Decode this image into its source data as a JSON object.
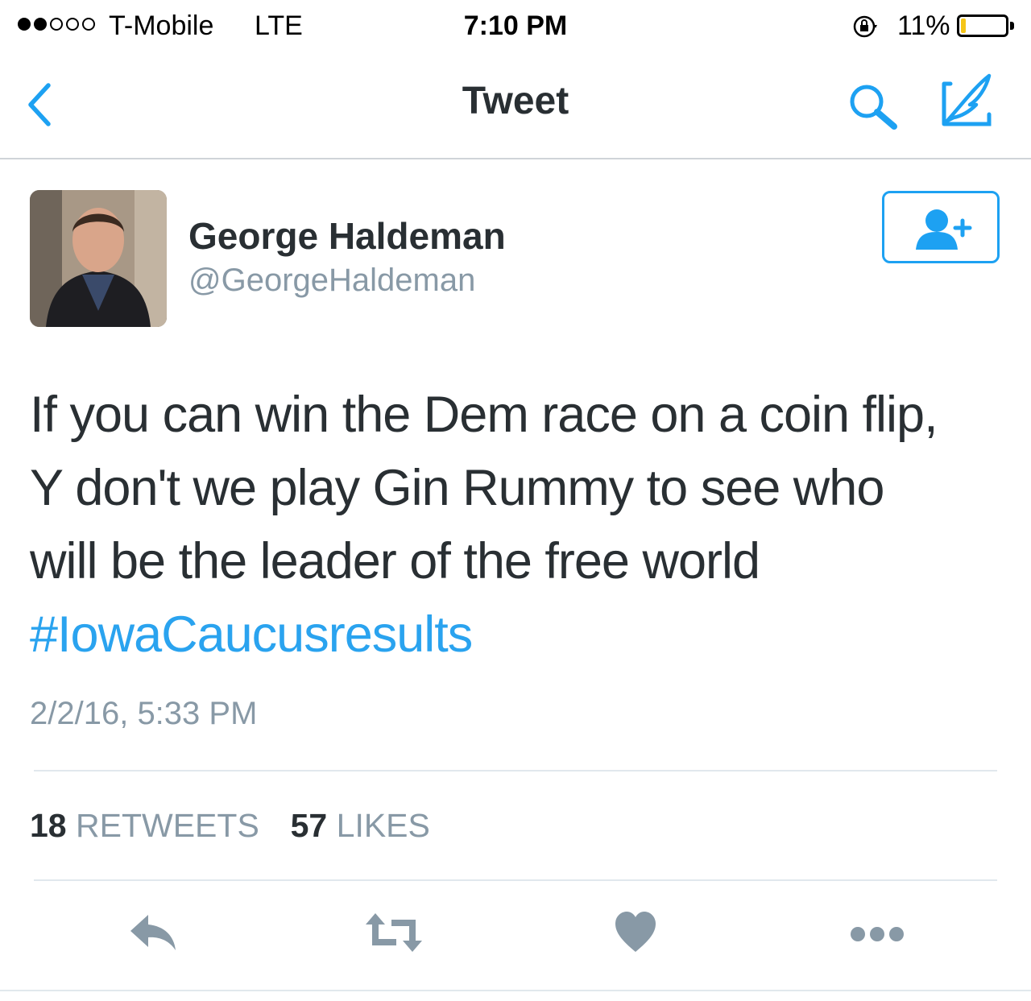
{
  "status_bar": {
    "carrier": "T-Mobile",
    "network": "LTE",
    "time": "7:10 PM",
    "battery": "11%",
    "battery_level": 0.11,
    "battery_color": "#f5c518",
    "signal_strength": 2,
    "signal_max": 5
  },
  "nav": {
    "title": "Tweet",
    "back_icon": "chevron-left-icon",
    "search_icon": "search-icon",
    "compose_icon": "compose-icon",
    "accent": "#1da1f2"
  },
  "tweet": {
    "author_name": "George Haldeman",
    "author_handle": "@GeorgeHaldeman",
    "follow_icon": "add-user-icon",
    "text_lines": [
      "If you can win the Dem race on a coin flip,",
      "Y don't we play Gin Rummy to see who",
      "will be the leader of the free world"
    ],
    "hashtag": "#IowaCaucusresults",
    "timestamp": "2/2/16, 5:33 PM",
    "retweets_count": "18",
    "retweets_label": "RETWEETS",
    "likes_count": "57",
    "likes_label": "LIKES"
  },
  "actions": {
    "reply_icon": "reply-icon",
    "retweet_icon": "retweet-icon",
    "like_icon": "heart-icon",
    "more_icon": "more-icon",
    "icon_color": "#8899a6"
  }
}
